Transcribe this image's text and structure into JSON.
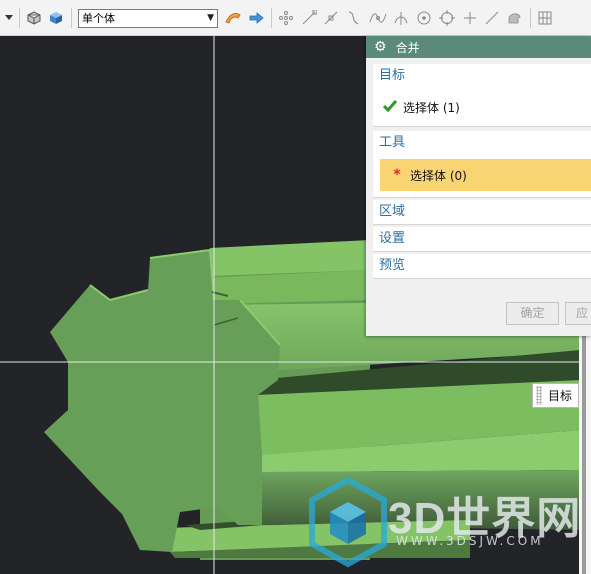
{
  "toolbar": {
    "filter_value": "单个体",
    "icons": [
      "dropdown-arrow",
      "box-shaded",
      "cube-solid",
      "flag-select",
      "arrow-right",
      "snap-points",
      "line-endpoint",
      "midpoint",
      "curve-point",
      "spline-point",
      "intersection",
      "circle-center",
      "quadrant",
      "existing-point",
      "line-on-curve",
      "face-icon",
      "grid-icon"
    ]
  },
  "dialog": {
    "title": "合并",
    "target": {
      "heading": "目标",
      "selection_label": "选择体 (1)",
      "status": "done"
    },
    "tool": {
      "heading": "工具",
      "selection_label": "选择体 (0)",
      "status": "required"
    },
    "region_label": "区域",
    "settings_label": "设置",
    "preview_label": "预览",
    "ok_label": "确定",
    "apply_label": "应"
  },
  "tooltip": {
    "text": "目标"
  },
  "watermark": {
    "main": "3D世界网",
    "sub": "WWW.3DSJW.COM"
  },
  "colors": {
    "viewport_bg": "#232428",
    "title_bar": "#5b8a7c",
    "required_highlight": "#f8d572",
    "model_face": "#679f58",
    "model_light": "#8ccc6f"
  }
}
